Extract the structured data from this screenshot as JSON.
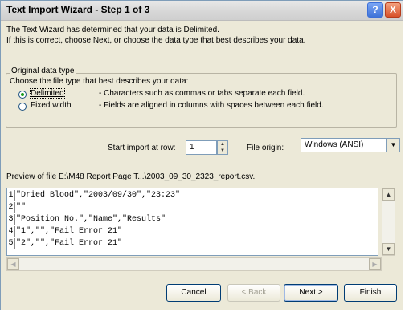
{
  "window": {
    "title": "Text Import Wizard - Step 1 of 3",
    "help_button": "?",
    "close_button": "X"
  },
  "intro": {
    "line1": "The Text Wizard has determined that your data is Delimited.",
    "line2": "If this is correct, choose Next, or choose the data type that best describes your data."
  },
  "original_data_type": {
    "group_label": "Original data type",
    "prompt": "Choose the file type that best describes your data:",
    "options": [
      {
        "label": "Delimited",
        "description": "- Characters such as commas or tabs separate each field.",
        "selected": true
      },
      {
        "label": "Fixed width",
        "description": "- Fields are aligned in columns with spaces between each field.",
        "selected": false
      }
    ]
  },
  "start_import": {
    "label": "Start import at row:",
    "value": "1"
  },
  "file_origin": {
    "label": "File origin:",
    "value": "Windows (ANSI)"
  },
  "preview": {
    "label": "Preview of file E:\\M48 Report Page T...\\2003_09_30_2323_report.csv.",
    "rows": [
      {
        "num": "1",
        "text": "\"Dried Blood\",\"2003/09/30\",\"23:23\""
      },
      {
        "num": "2",
        "text": "\"\""
      },
      {
        "num": "3",
        "text": "\"Position No.\",\"Name\",\"Results\""
      },
      {
        "num": "4",
        "text": "\"1\",\"\",\"Fail  Error 21\""
      },
      {
        "num": "5",
        "text": "\"2\",\"\",\"Fail  Error 21\""
      }
    ]
  },
  "buttons": {
    "cancel": "Cancel",
    "back": "< Back",
    "next": "Next >",
    "finish": "Finish"
  },
  "icons": {
    "spin_up": "up-arrow-icon",
    "spin_down": "down-arrow-icon",
    "dropdown": "chevron-down-icon"
  }
}
